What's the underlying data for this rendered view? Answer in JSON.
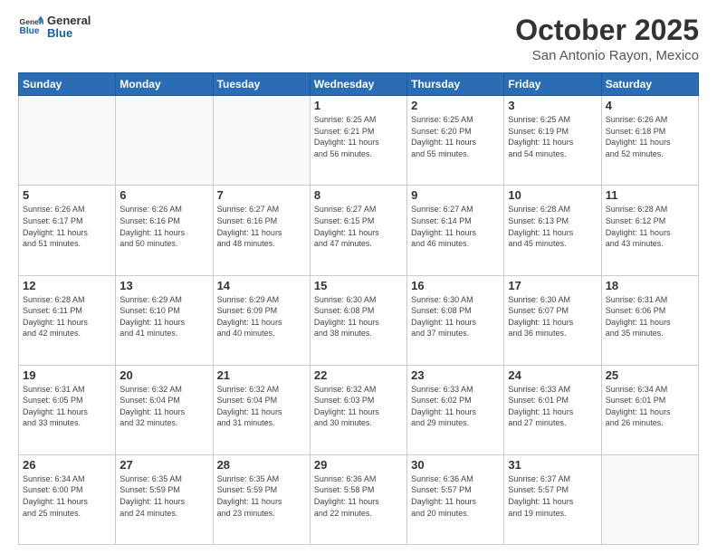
{
  "logo": {
    "line1": "General",
    "line2": "Blue"
  },
  "title": "October 2025",
  "location": "San Antonio Rayon, Mexico",
  "days_header": [
    "Sunday",
    "Monday",
    "Tuesday",
    "Wednesday",
    "Thursday",
    "Friday",
    "Saturday"
  ],
  "weeks": [
    [
      {
        "day": "",
        "info": ""
      },
      {
        "day": "",
        "info": ""
      },
      {
        "day": "",
        "info": ""
      },
      {
        "day": "1",
        "info": "Sunrise: 6:25 AM\nSunset: 6:21 PM\nDaylight: 11 hours\nand 56 minutes."
      },
      {
        "day": "2",
        "info": "Sunrise: 6:25 AM\nSunset: 6:20 PM\nDaylight: 11 hours\nand 55 minutes."
      },
      {
        "day": "3",
        "info": "Sunrise: 6:25 AM\nSunset: 6:19 PM\nDaylight: 11 hours\nand 54 minutes."
      },
      {
        "day": "4",
        "info": "Sunrise: 6:26 AM\nSunset: 6:18 PM\nDaylight: 11 hours\nand 52 minutes."
      }
    ],
    [
      {
        "day": "5",
        "info": "Sunrise: 6:26 AM\nSunset: 6:17 PM\nDaylight: 11 hours\nand 51 minutes."
      },
      {
        "day": "6",
        "info": "Sunrise: 6:26 AM\nSunset: 6:16 PM\nDaylight: 11 hours\nand 50 minutes."
      },
      {
        "day": "7",
        "info": "Sunrise: 6:27 AM\nSunset: 6:16 PM\nDaylight: 11 hours\nand 48 minutes."
      },
      {
        "day": "8",
        "info": "Sunrise: 6:27 AM\nSunset: 6:15 PM\nDaylight: 11 hours\nand 47 minutes."
      },
      {
        "day": "9",
        "info": "Sunrise: 6:27 AM\nSunset: 6:14 PM\nDaylight: 11 hours\nand 46 minutes."
      },
      {
        "day": "10",
        "info": "Sunrise: 6:28 AM\nSunset: 6:13 PM\nDaylight: 11 hours\nand 45 minutes."
      },
      {
        "day": "11",
        "info": "Sunrise: 6:28 AM\nSunset: 6:12 PM\nDaylight: 11 hours\nand 43 minutes."
      }
    ],
    [
      {
        "day": "12",
        "info": "Sunrise: 6:28 AM\nSunset: 6:11 PM\nDaylight: 11 hours\nand 42 minutes."
      },
      {
        "day": "13",
        "info": "Sunrise: 6:29 AM\nSunset: 6:10 PM\nDaylight: 11 hours\nand 41 minutes."
      },
      {
        "day": "14",
        "info": "Sunrise: 6:29 AM\nSunset: 6:09 PM\nDaylight: 11 hours\nand 40 minutes."
      },
      {
        "day": "15",
        "info": "Sunrise: 6:30 AM\nSunset: 6:08 PM\nDaylight: 11 hours\nand 38 minutes."
      },
      {
        "day": "16",
        "info": "Sunrise: 6:30 AM\nSunset: 6:08 PM\nDaylight: 11 hours\nand 37 minutes."
      },
      {
        "day": "17",
        "info": "Sunrise: 6:30 AM\nSunset: 6:07 PM\nDaylight: 11 hours\nand 36 minutes."
      },
      {
        "day": "18",
        "info": "Sunrise: 6:31 AM\nSunset: 6:06 PM\nDaylight: 11 hours\nand 35 minutes."
      }
    ],
    [
      {
        "day": "19",
        "info": "Sunrise: 6:31 AM\nSunset: 6:05 PM\nDaylight: 11 hours\nand 33 minutes."
      },
      {
        "day": "20",
        "info": "Sunrise: 6:32 AM\nSunset: 6:04 PM\nDaylight: 11 hours\nand 32 minutes."
      },
      {
        "day": "21",
        "info": "Sunrise: 6:32 AM\nSunset: 6:04 PM\nDaylight: 11 hours\nand 31 minutes."
      },
      {
        "day": "22",
        "info": "Sunrise: 6:32 AM\nSunset: 6:03 PM\nDaylight: 11 hours\nand 30 minutes."
      },
      {
        "day": "23",
        "info": "Sunrise: 6:33 AM\nSunset: 6:02 PM\nDaylight: 11 hours\nand 29 minutes."
      },
      {
        "day": "24",
        "info": "Sunrise: 6:33 AM\nSunset: 6:01 PM\nDaylight: 11 hours\nand 27 minutes."
      },
      {
        "day": "25",
        "info": "Sunrise: 6:34 AM\nSunset: 6:01 PM\nDaylight: 11 hours\nand 26 minutes."
      }
    ],
    [
      {
        "day": "26",
        "info": "Sunrise: 6:34 AM\nSunset: 6:00 PM\nDaylight: 11 hours\nand 25 minutes."
      },
      {
        "day": "27",
        "info": "Sunrise: 6:35 AM\nSunset: 5:59 PM\nDaylight: 11 hours\nand 24 minutes."
      },
      {
        "day": "28",
        "info": "Sunrise: 6:35 AM\nSunset: 5:59 PM\nDaylight: 11 hours\nand 23 minutes."
      },
      {
        "day": "29",
        "info": "Sunrise: 6:36 AM\nSunset: 5:58 PM\nDaylight: 11 hours\nand 22 minutes."
      },
      {
        "day": "30",
        "info": "Sunrise: 6:36 AM\nSunset: 5:57 PM\nDaylight: 11 hours\nand 20 minutes."
      },
      {
        "day": "31",
        "info": "Sunrise: 6:37 AM\nSunset: 5:57 PM\nDaylight: 11 hours\nand 19 minutes."
      },
      {
        "day": "",
        "info": ""
      }
    ]
  ]
}
